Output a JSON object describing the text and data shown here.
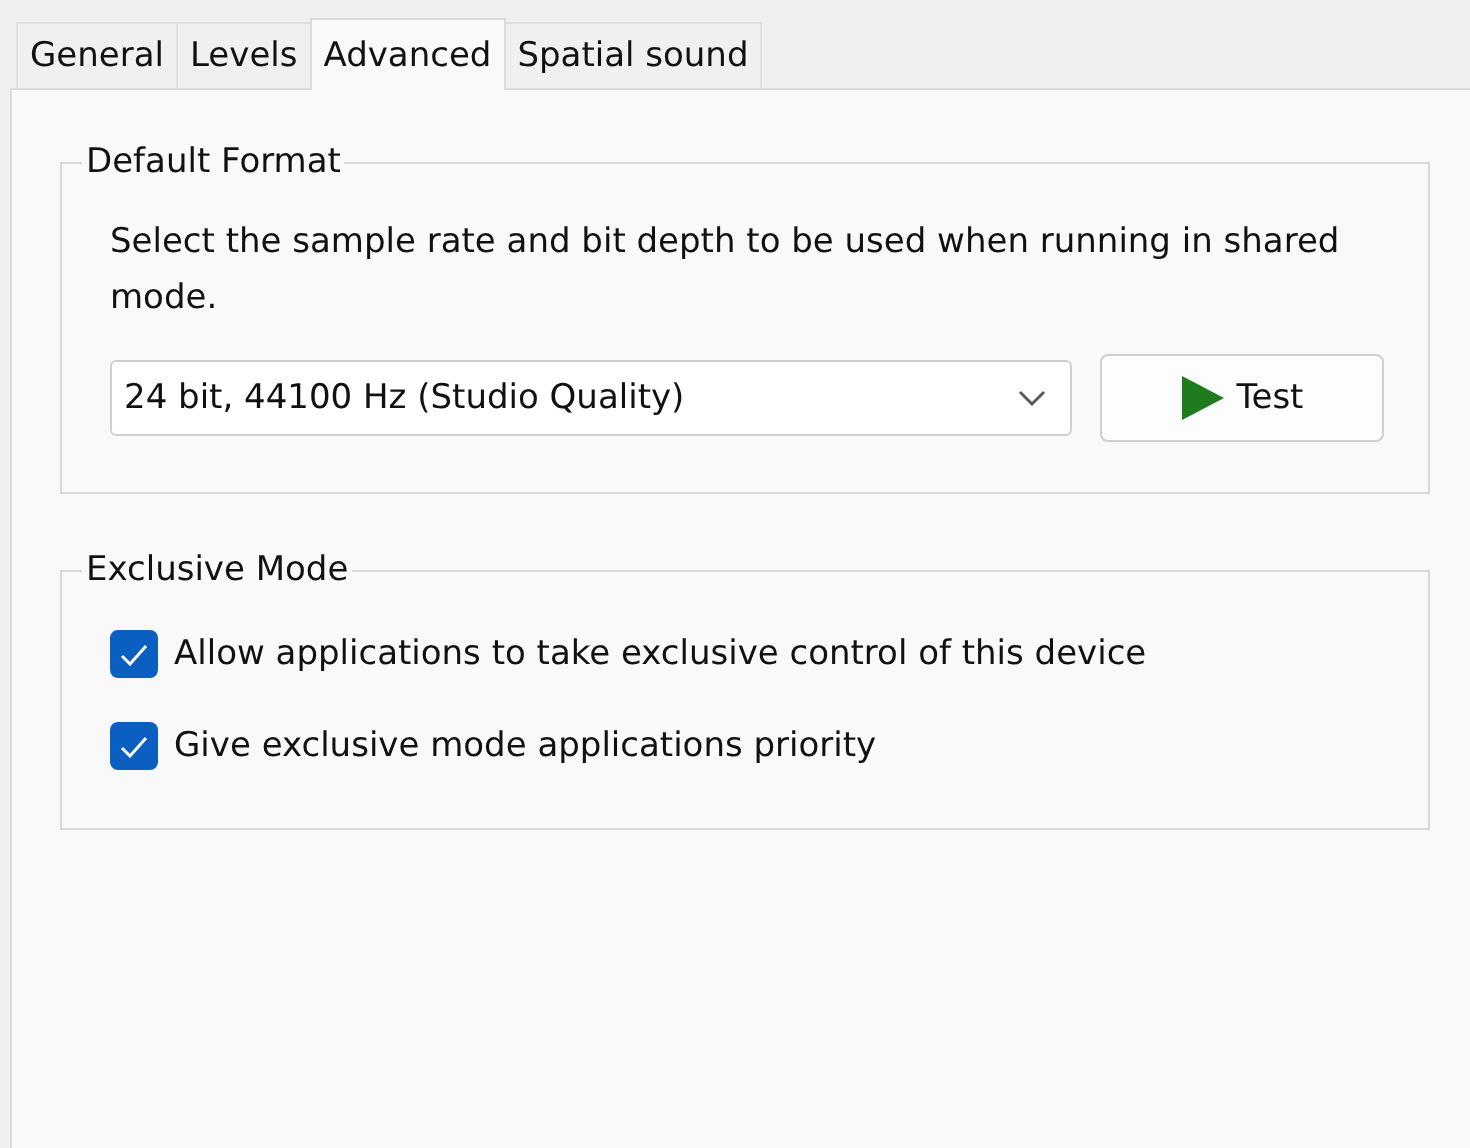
{
  "tabs": [
    {
      "label": "General",
      "selected": false
    },
    {
      "label": "Levels",
      "selected": false
    },
    {
      "label": "Advanced",
      "selected": true
    },
    {
      "label": "Spatial sound",
      "selected": false
    }
  ],
  "default_format": {
    "title": "Default Format",
    "description": "Select the sample rate and bit depth to be used when running in shared mode.",
    "format": "24 bit, 44100 Hz (Studio Quality)",
    "test_button": "Test"
  },
  "exclusive_mode": {
    "title": "Exclusive Mode",
    "options": [
      {
        "label": "Allow applications to take exclusive control of this device",
        "checked": true
      },
      {
        "label": "Give exclusive mode applications priority",
        "checked": true
      }
    ]
  }
}
